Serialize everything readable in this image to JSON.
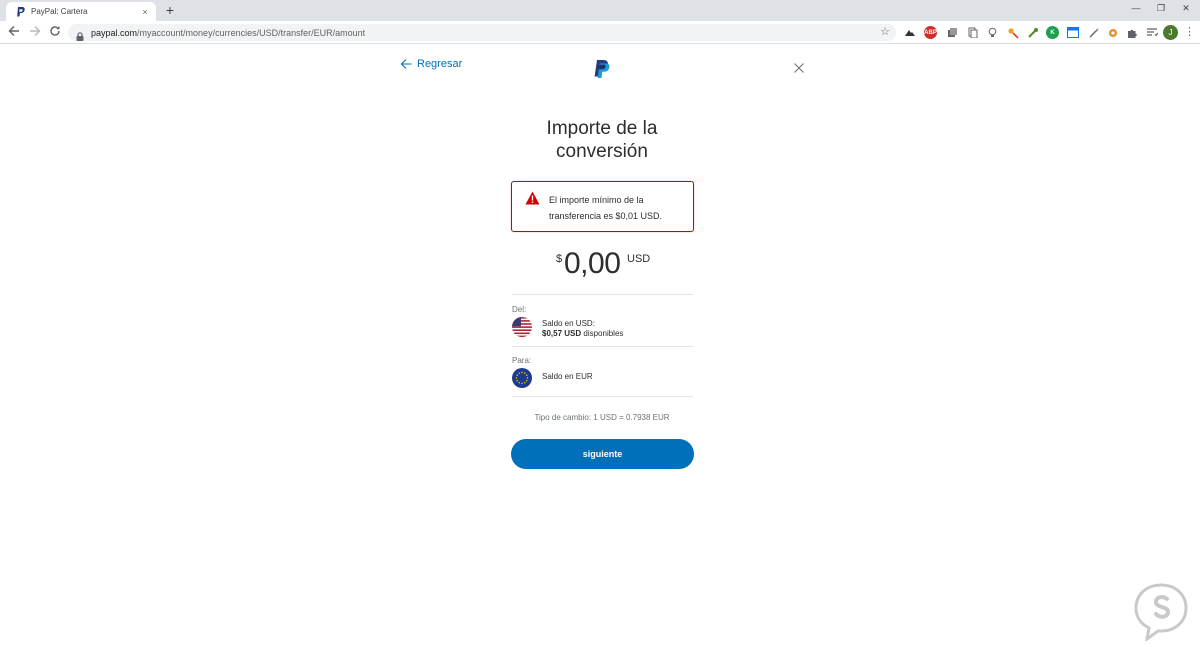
{
  "browser": {
    "tab_title": "PayPal: Cartera",
    "tab_close": "×",
    "new_tab": "+",
    "url_host": "paypal.com",
    "url_path": "/myaccount/money/currencies/USD/transfer/EUR/amount",
    "avatar_initial": "J",
    "abp_label": "ABP",
    "k_label": "K",
    "win_minimize": "—",
    "win_restore": "❐",
    "win_close": "✕"
  },
  "page": {
    "back_label": "Regresar",
    "title": "Importe de la conversión",
    "alert_message": "El importe mínimo de la transferencia es $0,01 USD.",
    "amount": {
      "symbol": "$",
      "value": "0,00",
      "currency": "USD"
    },
    "from": {
      "label": "Del:",
      "balance_name": "Saldo en USD:",
      "available_amount": "$0,57 USD",
      "available_suffix": " disponibles"
    },
    "to": {
      "label": "Para:",
      "balance_name": "Saldo en EUR"
    },
    "exchange_rate": "Tipo de cambio: 1 USD = 0.7938 EUR",
    "next_button": "siguiente"
  },
  "colors": {
    "brand_blue": "#0070ba",
    "alert_red": "#d20000",
    "tabbar_bg": "#dee1e6"
  }
}
